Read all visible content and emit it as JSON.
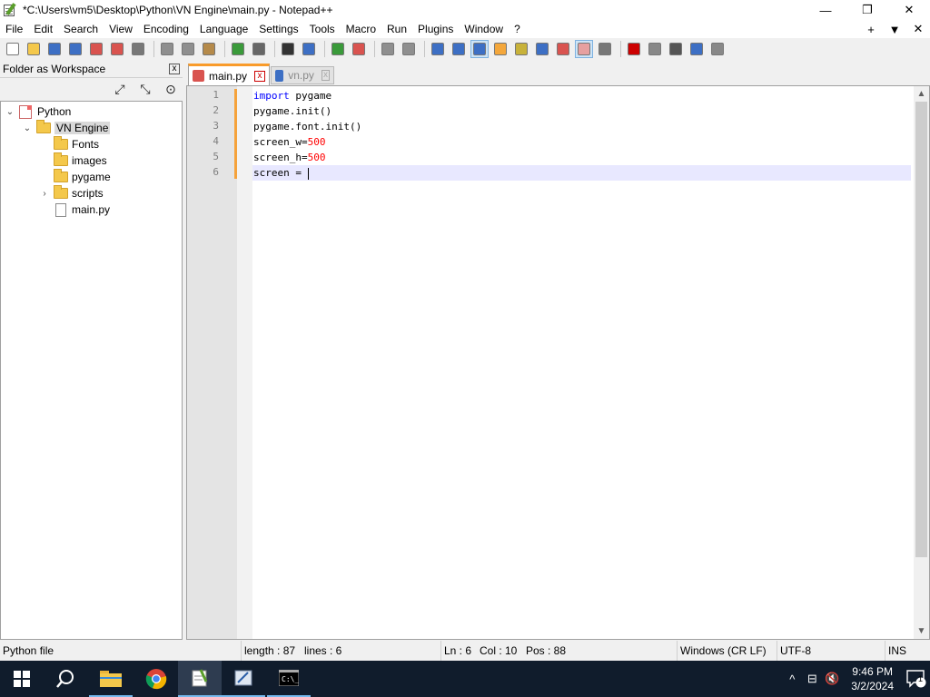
{
  "window": {
    "title": "*C:\\Users\\vm5\\Desktop\\Python\\VN Engine\\main.py - Notepad++",
    "minimize": "—",
    "maximize": "❐",
    "close": "✕"
  },
  "menu": {
    "items": [
      "File",
      "Edit",
      "Search",
      "View",
      "Encoding",
      "Language",
      "Settings",
      "Tools",
      "Macro",
      "Run",
      "Plugins",
      "Window",
      "?"
    ],
    "right_plus": "+",
    "right_down": "▼",
    "right_close": "✕"
  },
  "toolbar": {
    "icons": [
      {
        "name": "new-file-icon",
        "color": "#ffffff"
      },
      {
        "name": "open-file-icon",
        "color": "#f4c84b"
      },
      {
        "name": "save-icon",
        "color": "#3d6fc4"
      },
      {
        "name": "save-all-icon",
        "color": "#3d6fc4"
      },
      {
        "name": "close-icon",
        "color": "#d9534f"
      },
      {
        "name": "close-all-icon",
        "color": "#d9534f"
      },
      {
        "name": "print-icon",
        "color": "#777777"
      },
      {
        "name": "cut-icon",
        "color": "#8f8f8f"
      },
      {
        "name": "copy-icon",
        "color": "#8f8f8f"
      },
      {
        "name": "paste-icon",
        "color": "#b58a4a"
      },
      {
        "name": "undo-icon",
        "color": "#3a9a3a"
      },
      {
        "name": "redo-icon",
        "color": "#666666"
      },
      {
        "name": "find-icon",
        "color": "#333333"
      },
      {
        "name": "replace-icon",
        "color": "#3d6fc4"
      },
      {
        "name": "zoom-in-icon",
        "color": "#3a9a3a"
      },
      {
        "name": "zoom-out-icon",
        "color": "#d9534f"
      },
      {
        "name": "sync-vertical-icon",
        "color": "#8f8f8f"
      },
      {
        "name": "sync-horizontal-icon",
        "color": "#8f8f8f"
      },
      {
        "name": "word-wrap-icon",
        "color": "#3d6fc4"
      },
      {
        "name": "show-all-chars-icon",
        "color": "#3d6fc4"
      },
      {
        "name": "indent-guide-icon",
        "color": "#3d6fc4"
      },
      {
        "name": "udl-icon",
        "color": "#f4a73b"
      },
      {
        "name": "doc-map-icon",
        "color": "#c8b23a"
      },
      {
        "name": "function-list-icon",
        "color": "#3d6fc4"
      },
      {
        "name": "folder-workspace-icon",
        "color": "#d9534f"
      },
      {
        "name": "project-panel-icon",
        "color": "#e6a0a0"
      },
      {
        "name": "monitoring-icon",
        "color": "#777777"
      },
      {
        "name": "record-macro-icon",
        "color": "#cc0000"
      },
      {
        "name": "stop-record-icon",
        "color": "#888888"
      },
      {
        "name": "play-macro-icon",
        "color": "#555555"
      },
      {
        "name": "run-macro-multiple-icon",
        "color": "#3d6fc4"
      },
      {
        "name": "save-macro-icon",
        "color": "#888888"
      }
    ]
  },
  "sidepanel": {
    "title": "Folder as Workspace",
    "close": "x",
    "tools": [
      "⤢",
      "⤡",
      "⊙"
    ],
    "tree": [
      {
        "label": "Python",
        "level": 0,
        "type": "root",
        "expander": "⌄"
      },
      {
        "label": "VN Engine",
        "level": 1,
        "type": "folder",
        "expander": "⌄",
        "selected": true
      },
      {
        "label": "Fonts",
        "level": 2,
        "type": "folder",
        "expander": ""
      },
      {
        "label": "images",
        "level": 2,
        "type": "folder",
        "expander": ""
      },
      {
        "label": "pygame",
        "level": 2,
        "type": "folder",
        "expander": ""
      },
      {
        "label": "scripts",
        "level": 2,
        "type": "folder",
        "expander": "›"
      },
      {
        "label": "main.py",
        "level": 2,
        "type": "file",
        "expander": ""
      }
    ]
  },
  "tabs": [
    {
      "label": "main.py",
      "active": true,
      "icon_color": "#d9534f",
      "close": "x"
    },
    {
      "label": "vn.py",
      "active": false,
      "icon_color": "#3d6fc4",
      "close": "x"
    }
  ],
  "editor": {
    "line_numbers": [
      "1",
      "2",
      "3",
      "4",
      "5",
      "6"
    ],
    "lines": [
      [
        {
          "t": "import",
          "c": "kw"
        },
        {
          "t": " pygame",
          "c": ""
        }
      ],
      [
        {
          "t": "pygame.init()",
          "c": ""
        }
      ],
      [
        {
          "t": "pygame.font.init()",
          "c": ""
        }
      ],
      [
        {
          "t": "screen_w=",
          "c": ""
        },
        {
          "t": "500",
          "c": "num"
        }
      ],
      [
        {
          "t": "screen_h=",
          "c": ""
        },
        {
          "t": "500",
          "c": "num"
        }
      ],
      [
        {
          "t": "screen = ",
          "c": ""
        }
      ]
    ],
    "current_line": 6,
    "scroll_up": "▲",
    "scroll_down": "▼"
  },
  "statusbar": {
    "file_type": "Python file",
    "length": "length : 87",
    "lines": "lines : 6",
    "ln": "Ln : 6",
    "col": "Col : 10",
    "pos": "Pos : 88",
    "eol": "Windows (CR LF)",
    "encoding": "UTF-8",
    "mode": "INS"
  },
  "taskbar": {
    "time": "9:46 PM",
    "date": "3/2/2024",
    "notif_count": "1",
    "tray": [
      "^",
      "⊟",
      "🔇"
    ]
  }
}
